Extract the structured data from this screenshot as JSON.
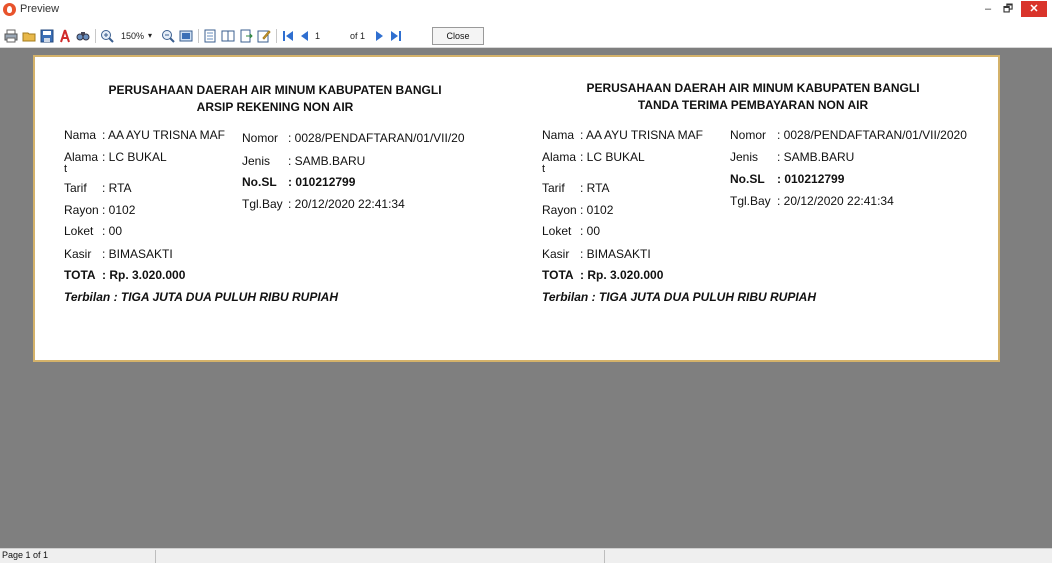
{
  "window": {
    "title": "Preview",
    "min_symbol": "–",
    "max_symbol": "🗗",
    "close_symbol": "✕"
  },
  "toolbar": {
    "zoom": "150%",
    "zoom_arrow": "▾",
    "page_current": "1",
    "page_of": "of 1",
    "close_label": "Close",
    "icons": [
      "print-icon",
      "open-icon",
      "save-icon",
      "pdf-icon",
      "find-icon",
      "zoom-in-icon",
      "zoom-out-icon",
      "fit-page-icon",
      "single-page-icon",
      "two-page-icon",
      "export-icon",
      "edit-icon",
      "first-page-icon",
      "prev-page-icon",
      "next-page-icon",
      "last-page-icon"
    ]
  },
  "receipts": [
    {
      "header_line1": "PERUSAHAAN DAERAH AIR MINUM KABUPATEN BANGLI",
      "header_line2": "ARSIP REKENING NON AIR",
      "nama_label": "Nama",
      "nama_value": ": AA AYU TRISNA MAF",
      "alama_label": "Alama",
      "alama_value": ": LC BUKAL",
      "alama_tail": "t",
      "tarif_label": "Tarif",
      "tarif_value": ": RTA",
      "rayon_label": "Rayon",
      "rayon_value": ": 0102",
      "loket_label": "Loket",
      "loket_value": ": 00",
      "kasir_label": "Kasir",
      "kasir_value": ": BIMASAKTI",
      "total_label": "TOTA",
      "total_value": ": Rp. 3.020.000",
      "terbilang": "Terbilan : TIGA JUTA DUA PULUH RIBU RUPIAH",
      "nomor_label": "Nomor",
      "nomor_value": ": 0028/PENDAFTARAN/01/VII/20",
      "jenis_label": "Jenis",
      "jenis_value": ": SAMB.BARU",
      "nosl_label": "No.SL",
      "nosl_value": ": 010212799",
      "tglbay_label": "Tgl.Bay",
      "tglbay_value": ": 20/12/2020 22:41:34"
    },
    {
      "header_line1": "PERUSAHAAN DAERAH AIR MINUM KABUPATEN BANGLI",
      "header_line2": "TANDA TERIMA PEMBAYARAN NON AIR",
      "nama_label": "Nama",
      "nama_value": ": AA AYU TRISNA MAF",
      "alama_label": "Alama",
      "alama_value": ": LC BUKAL",
      "alama_tail": "t",
      "tarif_label": "Tarif",
      "tarif_value": ": RTA",
      "rayon_label": "Rayon",
      "rayon_value": ": 0102",
      "loket_label": "Loket",
      "loket_value": ": 00",
      "kasir_label": "Kasir",
      "kasir_value": ": BIMASAKTI",
      "total_label": "TOTA",
      "total_value": ": Rp. 3.020.000",
      "terbilang": "Terbilan : TIGA JUTA DUA PULUH RIBU RUPIAH",
      "nomor_label": "Nomor",
      "nomor_value": ": 0028/PENDAFTARAN/01/VII/2020",
      "jenis_label": "Jenis",
      "jenis_value": ": SAMB.BARU",
      "nosl_label": "No.SL",
      "nosl_value": ": 010212799",
      "tglbay_label": "Tgl.Bay",
      "tglbay_value": ": 20/12/2020 22:41:34"
    }
  ],
  "status": {
    "page_text": "Page 1 of 1"
  }
}
